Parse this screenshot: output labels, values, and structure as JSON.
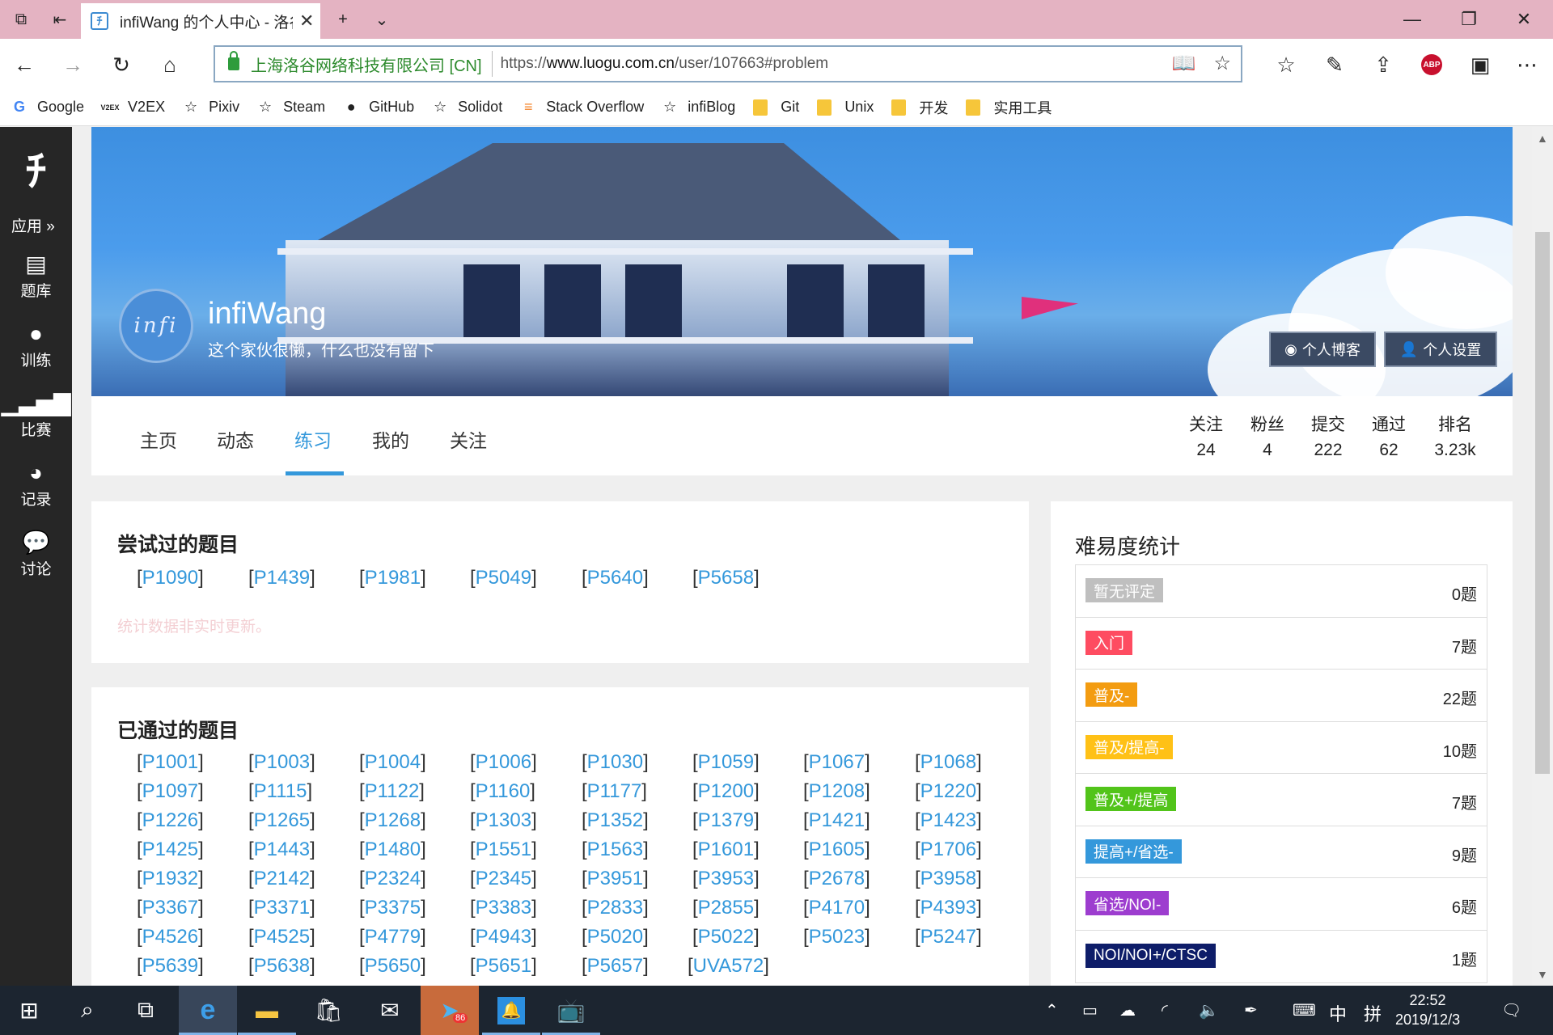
{
  "browser": {
    "tab_title": "infiWang 的个人中心 - 洛谷",
    "cert_label": "上海洛谷网络科技有限公司 [CN]",
    "url_prefix": "https://",
    "url_host": "www.luogu.com.cn",
    "url_path": "/user/107663#problem"
  },
  "bookmarks": [
    {
      "label": "Google",
      "icon": "google-icon"
    },
    {
      "label": "V2EX",
      "icon": "v2ex-icon"
    },
    {
      "label": "Pixiv",
      "icon": "star-icon"
    },
    {
      "label": "Steam",
      "icon": "star-icon"
    },
    {
      "label": "GitHub",
      "icon": "github-icon"
    },
    {
      "label": "Solidot",
      "icon": "star-icon"
    },
    {
      "label": "Stack Overflow",
      "icon": "stackoverflow-icon"
    },
    {
      "label": "infiBlog",
      "icon": "star-icon"
    },
    {
      "label": "Git",
      "icon": "folder-icon"
    },
    {
      "label": "Unix",
      "icon": "folder-icon"
    },
    {
      "label": "开发",
      "icon": "folder-icon"
    },
    {
      "label": "实用工具",
      "icon": "folder-icon"
    }
  ],
  "sidebar": {
    "apps_label": "应用 »",
    "items": [
      {
        "label": "题库",
        "icon": "book-icon"
      },
      {
        "label": "训练",
        "icon": "lightbulb-icon"
      },
      {
        "label": "比赛",
        "icon": "signal-bars-icon"
      },
      {
        "label": "记录",
        "icon": "pie-chart-icon"
      },
      {
        "label": "讨论",
        "icon": "chat-bubbles-icon"
      }
    ]
  },
  "profile": {
    "avatar_text": "infi",
    "username": "infiWang",
    "motto": "这个家伙很懒，什么也没有留下",
    "blog_button": "个人博客",
    "settings_button": "个人设置"
  },
  "tabs": [
    "主页",
    "动态",
    "练习",
    "我的",
    "关注"
  ],
  "active_tab": "练习",
  "stats": [
    {
      "label": "关注",
      "value": "24"
    },
    {
      "label": "粉丝",
      "value": "4"
    },
    {
      "label": "提交",
      "value": "222"
    },
    {
      "label": "通过",
      "value": "62"
    },
    {
      "label": "排名",
      "value": "3.23k"
    }
  ],
  "attempted": {
    "title": "尝试过的题目",
    "problems": [
      "P1090",
      "P1439",
      "P1981",
      "P5049",
      "P5640",
      "P5658"
    ],
    "note": "统计数据非实时更新。"
  },
  "passed": {
    "title": "已通过的题目",
    "problems": [
      "P1001",
      "P1003",
      "P1004",
      "P1006",
      "P1030",
      "P1059",
      "P1067",
      "P1068",
      "P1097",
      "P1115",
      "P1122",
      "P1160",
      "P1177",
      "P1200",
      "P1208",
      "P1220",
      "P1226",
      "P1265",
      "P1268",
      "P1303",
      "P1352",
      "P1379",
      "P1421",
      "P1423",
      "P1425",
      "P1443",
      "P1480",
      "P1551",
      "P1563",
      "P1601",
      "P1605",
      "P1706",
      "P1932",
      "P2142",
      "P2324",
      "P2345",
      "P3951",
      "P3953",
      "P2678",
      "P3958",
      "P3367",
      "P3371",
      "P3375",
      "P3383",
      "P2833",
      "P2855",
      "P4170",
      "P4393",
      "P4526",
      "P4525",
      "P4779",
      "P4943",
      "P5020",
      "P5022",
      "P5023",
      "P5247",
      "P5639",
      "P5638",
      "P5650",
      "P5651",
      "P5657",
      "UVA572"
    ]
  },
  "difficulty": {
    "title": "难易度统计",
    "rows": [
      {
        "label": "暂无评定",
        "count": "0题",
        "color": "#bfbfbf"
      },
      {
        "label": "入门",
        "count": "7题",
        "color": "#fe4c61"
      },
      {
        "label": "普及-",
        "count": "22题",
        "color": "#f39c11"
      },
      {
        "label": "普及/提高-",
        "count": "10题",
        "color": "#ffc116"
      },
      {
        "label": "普及+/提高",
        "count": "7题",
        "color": "#52c41a"
      },
      {
        "label": "提高+/省选-",
        "count": "9题",
        "color": "#3498db"
      },
      {
        "label": "省选/NOI-",
        "count": "6题",
        "color": "#9d3dcf"
      },
      {
        "label": "NOI/NOI+/CTSC",
        "count": "1题",
        "color": "#0e1d69"
      }
    ]
  },
  "taskbar": {
    "telegram_badge": "86",
    "ime_lang": "中",
    "ime_mode": "拼",
    "time": "22:52",
    "date": "2019/12/3"
  }
}
